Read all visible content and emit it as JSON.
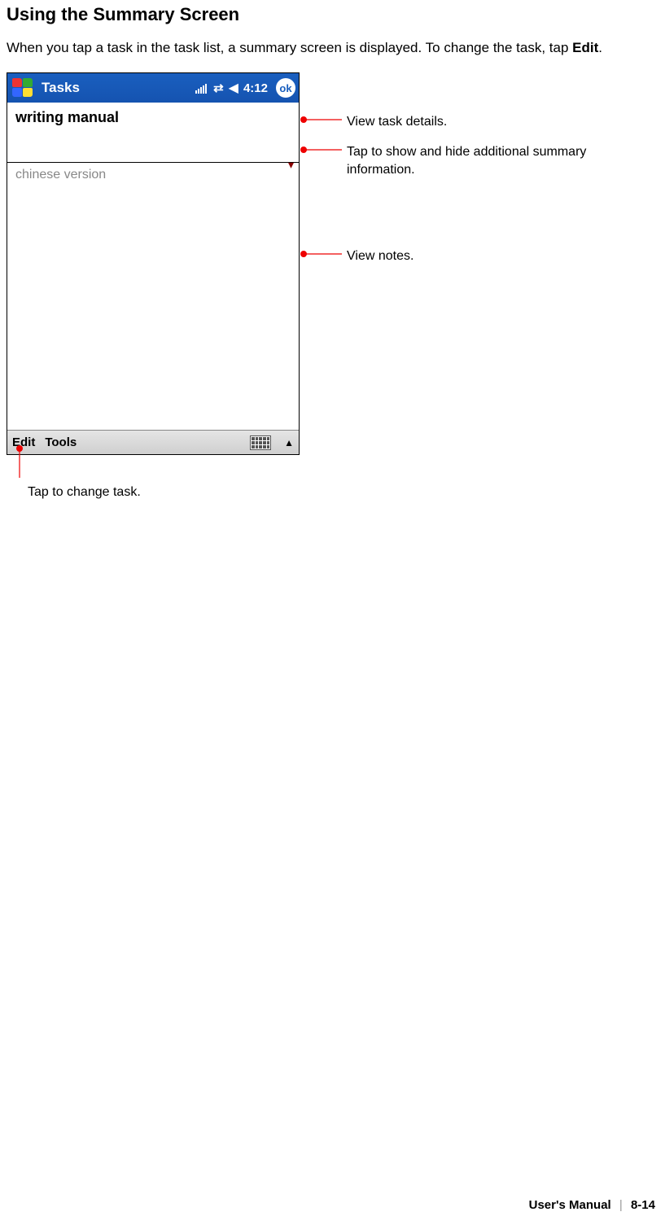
{
  "heading": "Using the Summary Screen",
  "intro_pre": "When you tap a task in the task list, a summary screen is displayed. To change the task, tap ",
  "intro_bold": "Edit",
  "intro_post": ".",
  "screenshot": {
    "titlebar": {
      "title": "Tasks",
      "time": "4:12",
      "ok": "ok"
    },
    "content": {
      "task_title": "writing manual",
      "notes": "chinese version"
    },
    "bottombar": {
      "edit": "Edit",
      "tools": "Tools"
    }
  },
  "callouts": {
    "c1": "View task details.",
    "c2": "Tap to show and hide additional summary information.",
    "c3": "View notes.",
    "c4": "Tap to change task."
  },
  "footer": {
    "left": "User's Manual",
    "right": "8-14"
  }
}
